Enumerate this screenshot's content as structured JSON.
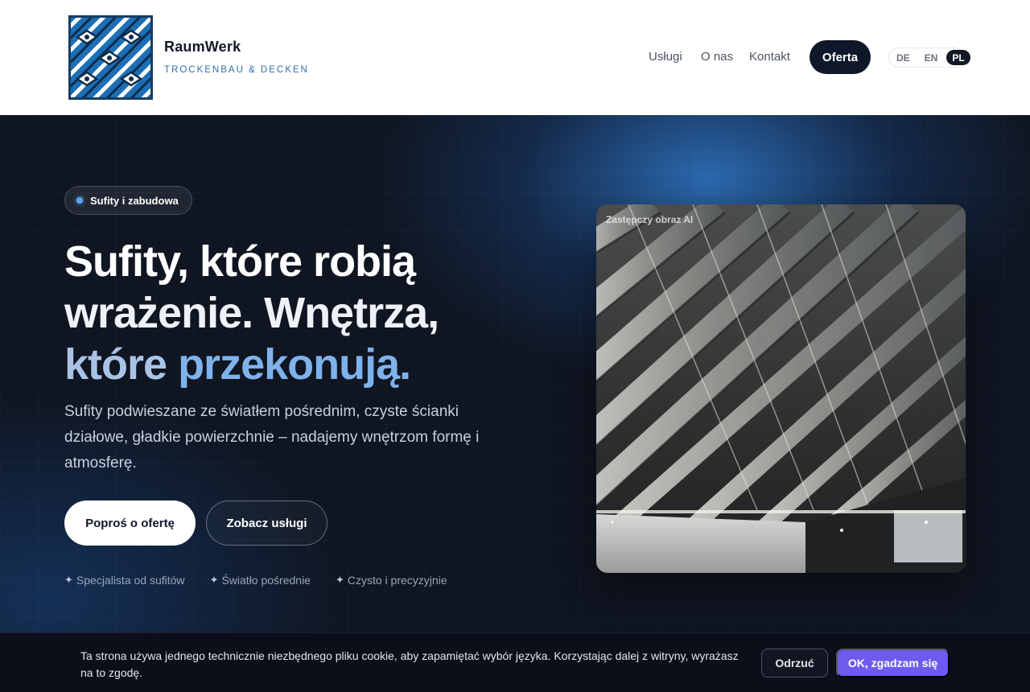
{
  "brand": {
    "name": "RaumWerk",
    "tagline": "TROCKENBAU & DECKEN",
    "logo_colors": [
      "#1c6fb5",
      "#ffffff",
      "#163d63"
    ]
  },
  "nav": {
    "links": [
      {
        "label": "Usługi"
      },
      {
        "label": "O nas"
      },
      {
        "label": "Kontakt"
      }
    ],
    "cta_label": "Oferta",
    "languages": [
      {
        "code": "DE",
        "active": false
      },
      {
        "code": "EN",
        "active": false
      },
      {
        "code": "PL",
        "active": true
      }
    ]
  },
  "hero": {
    "badge": "Sufity i zabudowa",
    "headline": {
      "part1": "Sufity, które robią",
      "part2": "wrażenie. Wnętrza,",
      "part3a": "które ",
      "part3b": "przekonują."
    },
    "lead": "Sufity podwieszane ze światłem pośrednim, czyste ścianki działowe, gładkie powierzchnie – nadajemy wnętrzom formę i atmosferę.",
    "primary_button": "Poproś o ofertę",
    "secondary_button": "Zobacz usługi",
    "features": [
      {
        "icon": "sparkle-icon",
        "label": "Specjalista od sufitów"
      },
      {
        "icon": "sparkle-icon",
        "label": "Światło pośrednie"
      },
      {
        "icon": "sparkle-icon",
        "label": "Czysto i precyzyjnie"
      }
    ],
    "image_caption": "Zastępczy obraz AI"
  },
  "cookie": {
    "text": "Ta strona używa jednego technicznie niezbędnego pliku cookie, aby zapamiętać wybór języka. Korzystając dalej z witryny, wyrażasz na to zgodę.",
    "reject_label": "Odrzuć",
    "accept_label": "OK, zgadzam się"
  },
  "colors": {
    "dark": "#0f172a",
    "accent_blue": "#7eb2ea",
    "cookie_accept": "#6d5bf0"
  }
}
